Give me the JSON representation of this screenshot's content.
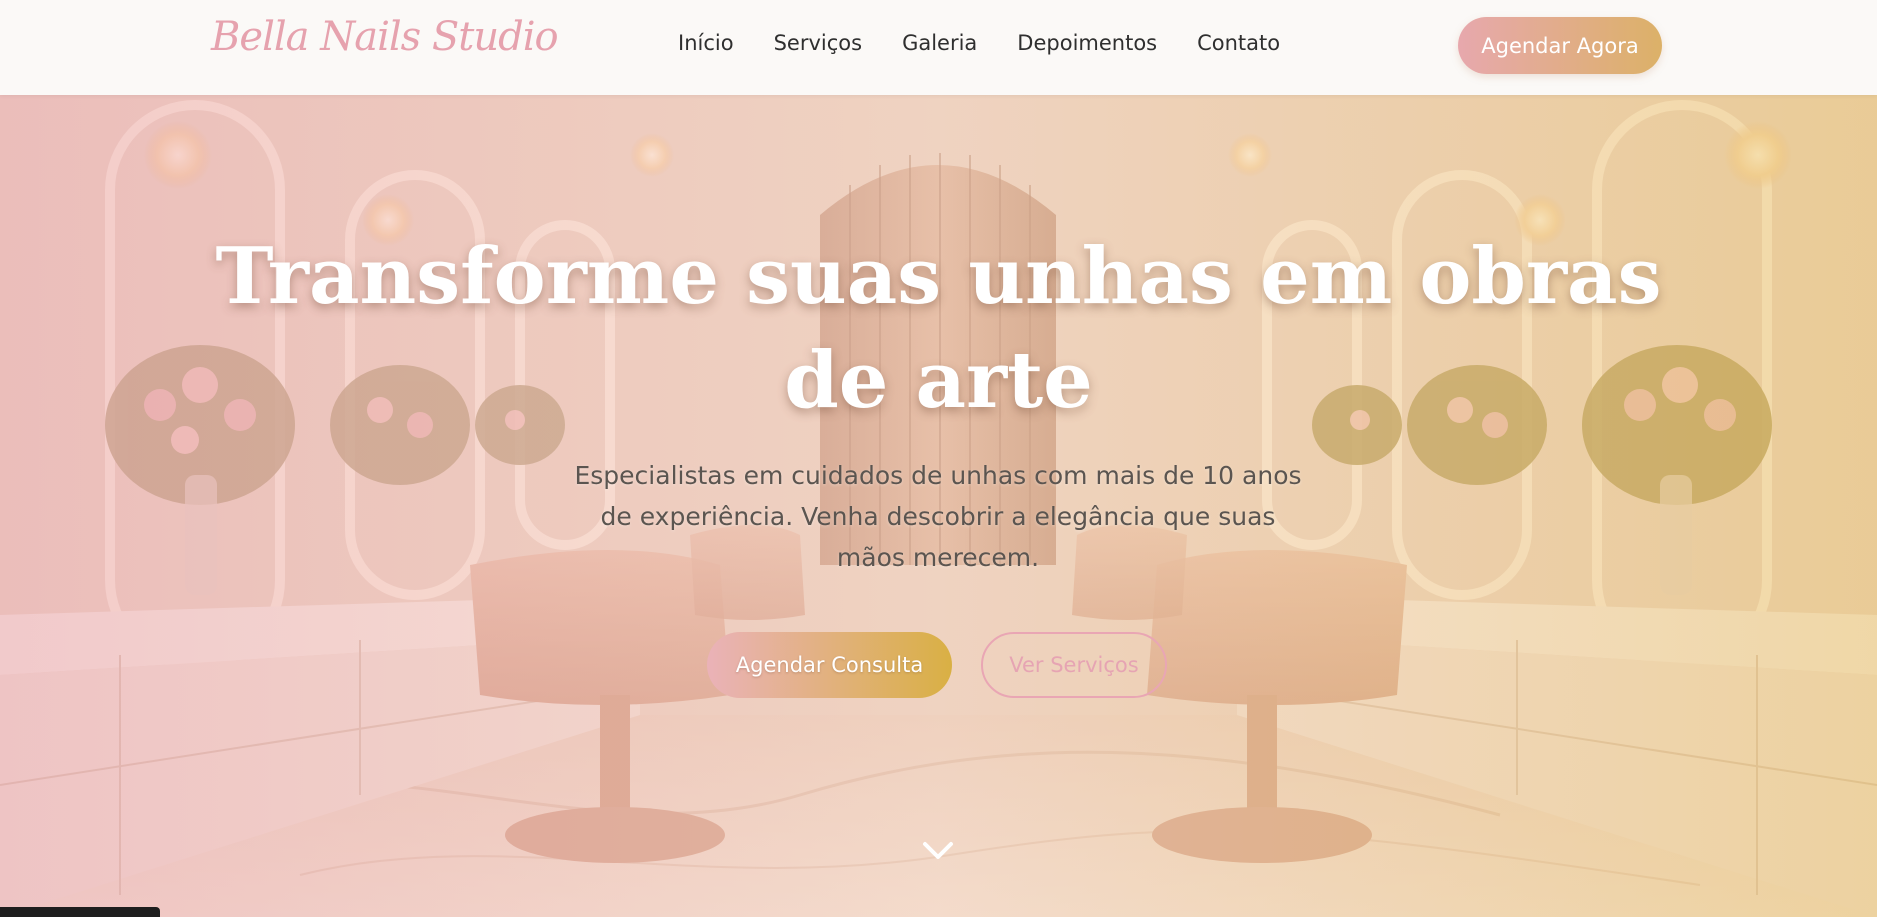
{
  "brand": {
    "logo_text": "Bella Nails Studio"
  },
  "nav": {
    "items": [
      "Início",
      "Serviços",
      "Galeria",
      "Depoimentos",
      "Contato"
    ],
    "cta_label": "Agendar Agora"
  },
  "hero": {
    "title": "Transforme suas unhas em obras de arte",
    "subtitle": "Especialistas em cuidados de unhas com mais de 10 anos de experiência. Venha descobrir a elegância que suas mãos merecem.",
    "primary_button": "Agendar Consulta",
    "secondary_button": "Ver Serviços",
    "scroll_icon": "chevron-down-icon"
  },
  "colors": {
    "brand_pink": "#e6a2ae",
    "brand_gold": "#dcb168",
    "nav_background": "#fbf9f7",
    "nav_text": "#2f2f2f"
  }
}
